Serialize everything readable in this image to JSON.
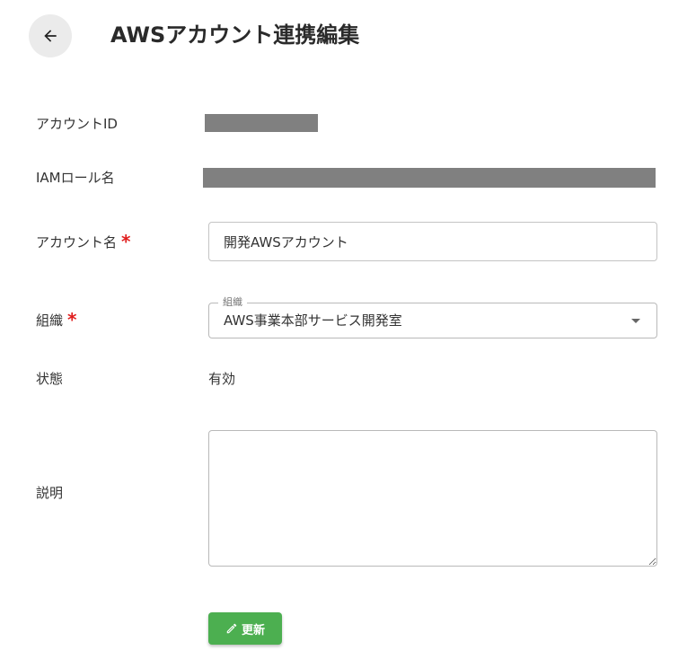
{
  "header": {
    "title": "AWSアカウント連携編集",
    "back_icon": "arrow-left-icon"
  },
  "form": {
    "account_id": {
      "label": "アカウントID",
      "value_redacted": true
    },
    "iam_role_name": {
      "label": "IAMロール名",
      "value_redacted": true
    },
    "account_name": {
      "label": "アカウント名",
      "required_mark": "*",
      "value": "開発AWSアカウント"
    },
    "organization": {
      "label": "組織",
      "required_mark": "*",
      "select_legend": "組織",
      "selected": "AWS事業本部サービス開発室",
      "caret_icon": "caret-down-icon"
    },
    "status": {
      "label": "状態",
      "value": "有効"
    },
    "description": {
      "label": "説明",
      "value": ""
    },
    "submit": {
      "label": "更新",
      "icon": "pencil-icon",
      "color": "#4caf50"
    }
  },
  "colors": {
    "required": "#e01e1e",
    "redaction": "#808080",
    "back_button_bg": "#ebebeb"
  }
}
